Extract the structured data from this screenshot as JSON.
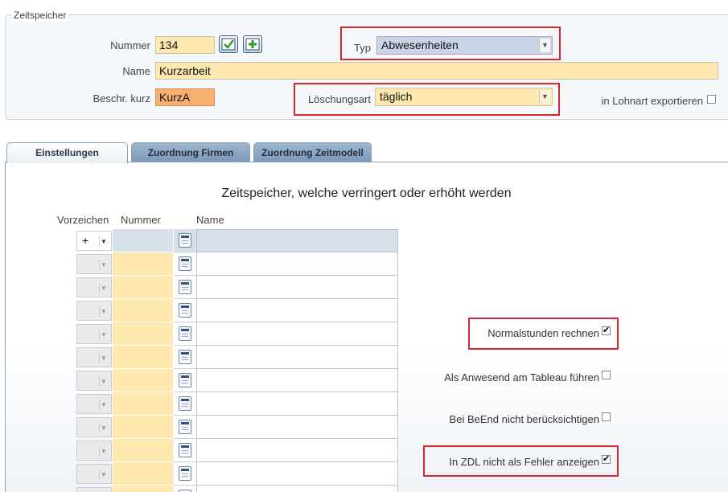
{
  "header": {
    "group_title": "Zeitspeicher",
    "nummer_label": "Nummer",
    "nummer_value": "134",
    "name_label": "Name",
    "name_value": "Kurzarbeit",
    "beschr_label": "Beschr. kurz",
    "beschr_value": "KurzA",
    "typ_label": "Typ",
    "typ_value": "Abwesenheiten",
    "loeschungsart_label": "Löschungsart",
    "loeschungsart_value": "täglich",
    "lohnart_label": "in Lohnart exportieren",
    "lohnart_checked": false
  },
  "tabs": [
    {
      "label": "Einstellungen",
      "active": true
    },
    {
      "label": "Zuordnung Firmen",
      "active": false
    },
    {
      "label": "Zuordnung Zeitmodell",
      "active": false
    }
  ],
  "section": {
    "title": "Zeitspeicher, welche verringert oder erhöht werden",
    "columns": [
      "Vorzeichen",
      "Nummer",
      "Name"
    ],
    "rows": [
      {
        "sign": "+",
        "nummer": "",
        "name": ""
      },
      {
        "sign": "",
        "nummer": "",
        "name": ""
      },
      {
        "sign": "",
        "nummer": "",
        "name": ""
      },
      {
        "sign": "",
        "nummer": "",
        "name": ""
      },
      {
        "sign": "",
        "nummer": "",
        "name": ""
      },
      {
        "sign": "",
        "nummer": "",
        "name": ""
      },
      {
        "sign": "",
        "nummer": "",
        "name": ""
      },
      {
        "sign": "",
        "nummer": "",
        "name": ""
      },
      {
        "sign": "",
        "nummer": "",
        "name": ""
      },
      {
        "sign": "",
        "nummer": "",
        "name": ""
      },
      {
        "sign": "",
        "nummer": "",
        "name": ""
      },
      {
        "sign": "",
        "nummer": "",
        "name": ""
      }
    ]
  },
  "options": {
    "normalstunden": {
      "label": "Normalstunden rechnen",
      "checked": true
    },
    "anwesend": {
      "label": "Als Anwesend am Tableau führen",
      "checked": false
    },
    "beend": {
      "label": "Bei BeEnd nicht berücksichtigen",
      "checked": false
    },
    "zdl": {
      "label": "In ZDL nicht als Fehler anzeigen",
      "checked": true
    }
  },
  "colors": {
    "highlight_red": "#d8262e",
    "field_yellow": "#ffe8b0",
    "field_orange": "#f8b070",
    "dropdown_blue": "#c9d5e6"
  }
}
